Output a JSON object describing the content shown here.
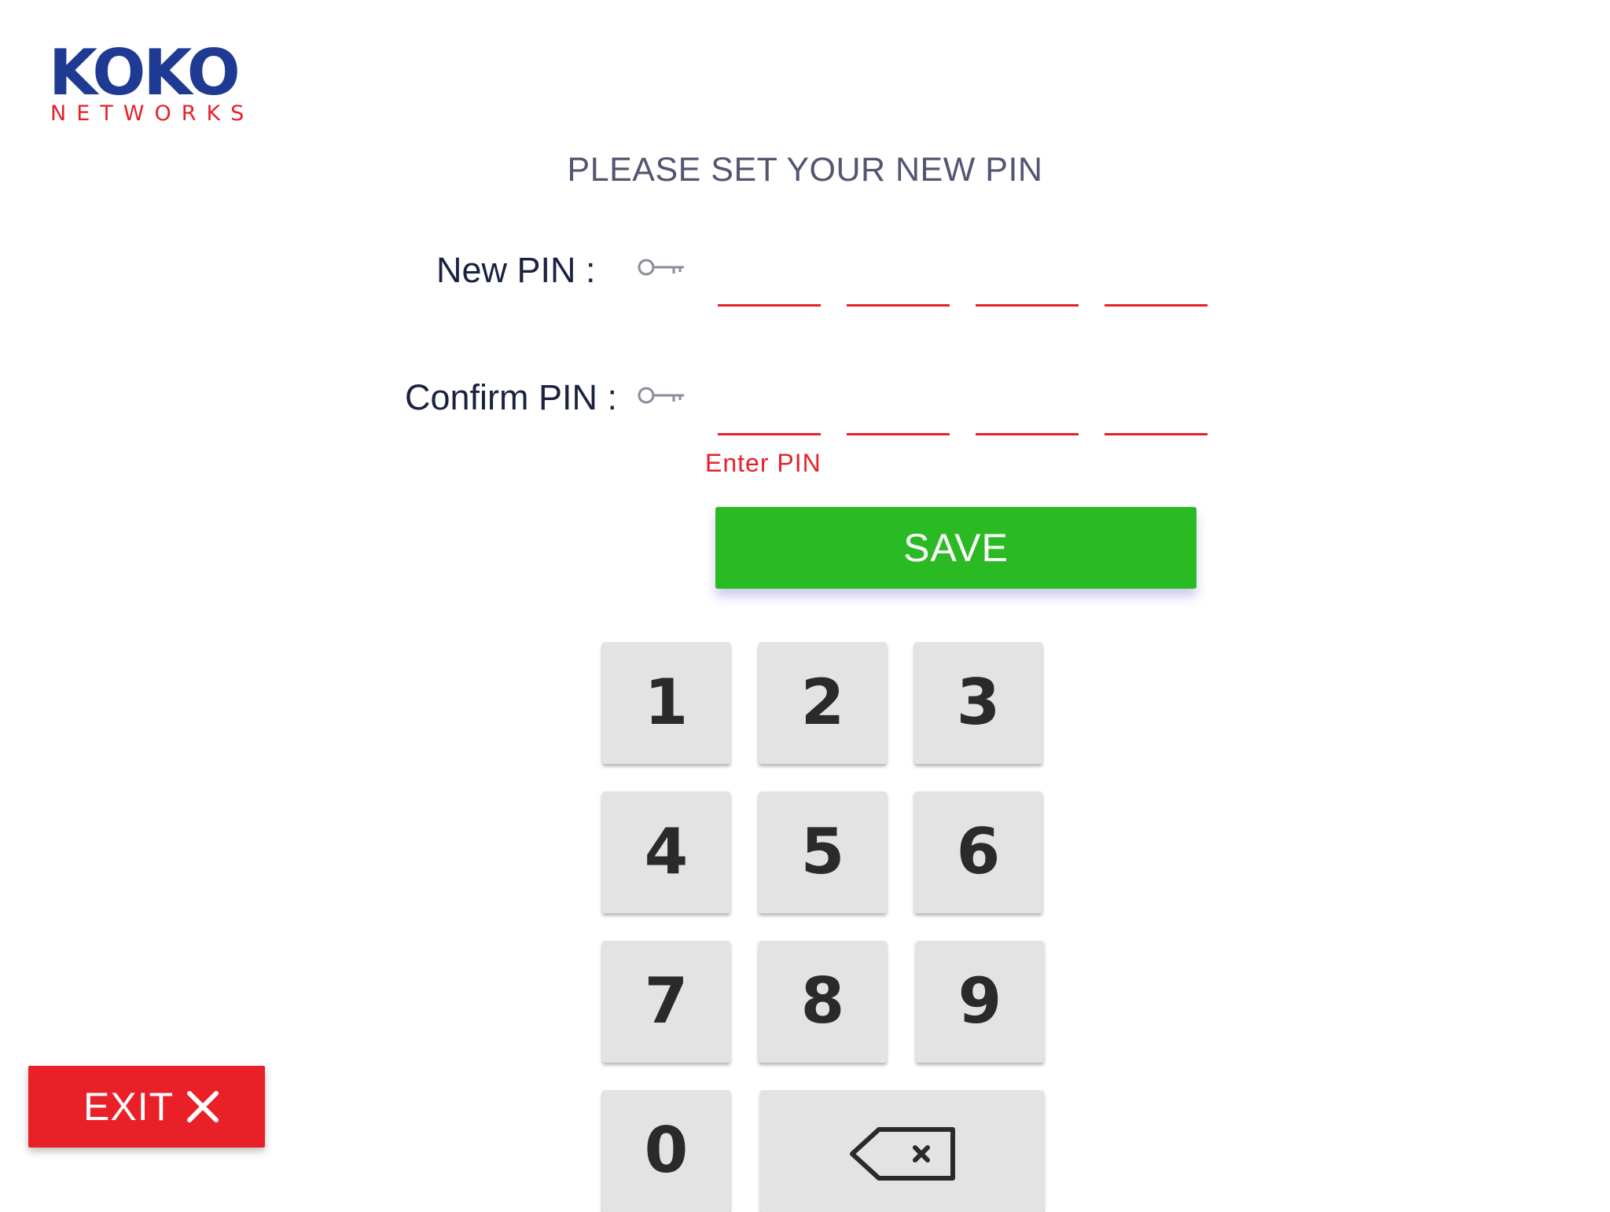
{
  "brand": {
    "name": "KOKO",
    "subtitle": "NETWORKS",
    "primary_color": "#1f3a93",
    "accent_color": "#e5212a"
  },
  "page": {
    "title": "PLEASE SET YOUR NEW PIN"
  },
  "form": {
    "new_pin": {
      "label": "New PIN :",
      "icon": "key-icon",
      "digits": [
        "",
        "",
        "",
        ""
      ]
    },
    "confirm_pin": {
      "label": "Confirm PIN :",
      "icon": "key-icon",
      "digits": [
        "",
        "",
        "",
        ""
      ]
    },
    "error_message": "Enter PIN",
    "save_label": "SAVE",
    "save_color": "#2aba24"
  },
  "keypad": {
    "keys": [
      "1",
      "2",
      "3",
      "4",
      "5",
      "6",
      "7",
      "8",
      "9",
      "0"
    ],
    "backspace_icon": "backspace-icon"
  },
  "exit": {
    "label": "EXIT",
    "icon": "close-icon",
    "color": "#ea2028"
  }
}
